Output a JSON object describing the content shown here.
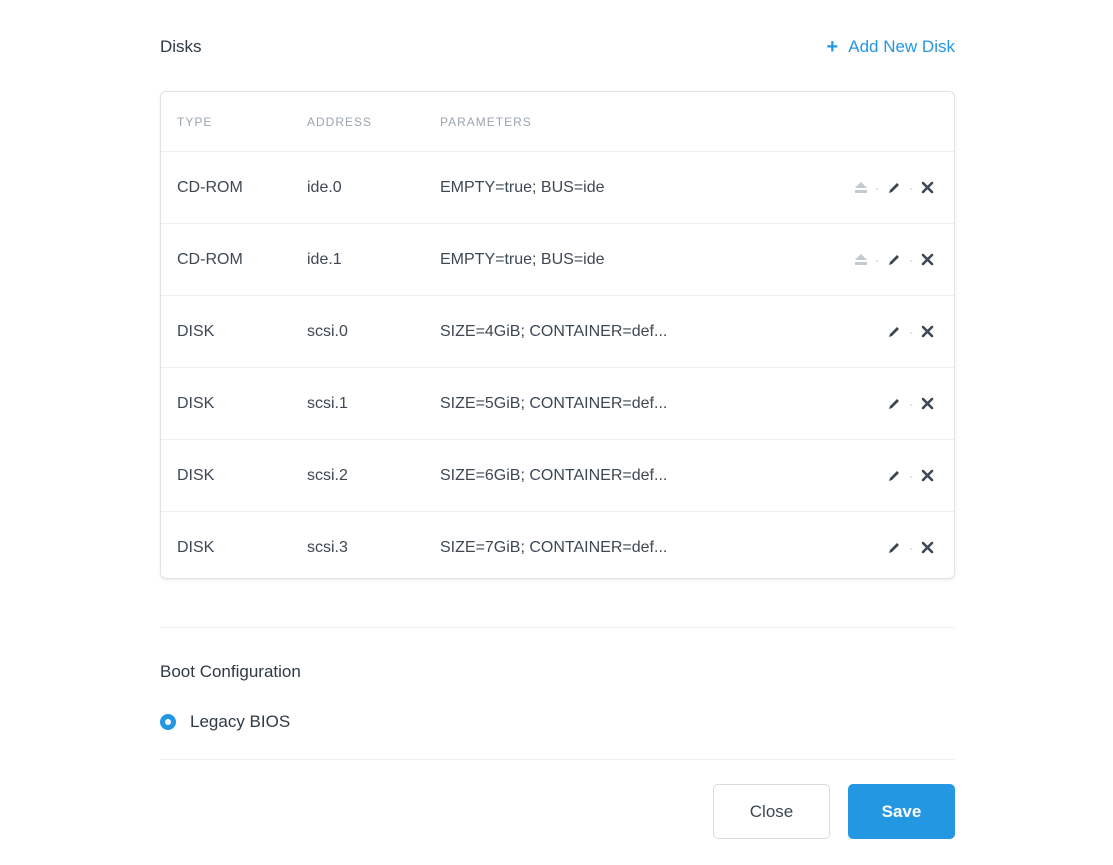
{
  "disks": {
    "title": "Disks",
    "add_new_label": "Add New Disk",
    "columns": [
      "TYPE",
      "ADDRESS",
      "PARAMETERS"
    ],
    "rows": [
      {
        "type": "CD-ROM",
        "address": "ide.0",
        "parameters": "EMPTY=true; BUS=ide",
        "actions": [
          "eject",
          "edit",
          "delete"
        ]
      },
      {
        "type": "CD-ROM",
        "address": "ide.1",
        "parameters": "EMPTY=true; BUS=ide",
        "actions": [
          "eject",
          "edit",
          "delete"
        ]
      },
      {
        "type": "DISK",
        "address": "scsi.0",
        "parameters": "SIZE=4GiB; CONTAINER=def...",
        "actions": [
          "edit",
          "delete"
        ]
      },
      {
        "type": "DISK",
        "address": "scsi.1",
        "parameters": "SIZE=5GiB; CONTAINER=def...",
        "actions": [
          "edit",
          "delete"
        ]
      },
      {
        "type": "DISK",
        "address": "scsi.2",
        "parameters": "SIZE=6GiB; CONTAINER=def...",
        "actions": [
          "edit",
          "delete"
        ]
      },
      {
        "type": "DISK",
        "address": "scsi.3",
        "parameters": "SIZE=7GiB; CONTAINER=def...",
        "actions": [
          "edit",
          "delete"
        ]
      }
    ]
  },
  "boot": {
    "title": "Boot Configuration",
    "option_label": "Legacy BIOS",
    "selected": true
  },
  "footer": {
    "close_label": "Close",
    "save_label": "Save"
  },
  "colors": {
    "accent": "#2497e3",
    "text": "#3d4853",
    "muted": "#9aa5b0"
  }
}
